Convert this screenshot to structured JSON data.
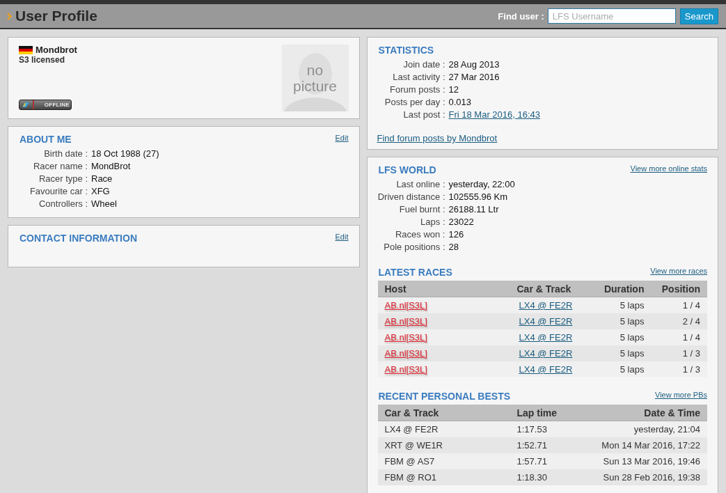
{
  "header": {
    "title": "User Profile",
    "find_label": "Find user :",
    "search": {
      "placeholder": "LFS Username"
    },
    "search_button": "Search"
  },
  "profile": {
    "name": "Mondbrot",
    "license": "S3 licensed",
    "status": "OFFLINE",
    "online": false,
    "picture_text": "no picture"
  },
  "about": {
    "title": "ABOUT ME",
    "edit": "Edit",
    "fields": [
      {
        "label": "Birth date :",
        "value": "18 Oct 1988 (27)"
      },
      {
        "label": "Racer name :",
        "value": "MondBrot"
      },
      {
        "label": "Racer type :",
        "value": "Race"
      },
      {
        "label": "Favourite car :",
        "value": "XFG"
      },
      {
        "label": "Controllers :",
        "value": "Wheel"
      }
    ]
  },
  "contact": {
    "title": "CONTACT INFORMATION",
    "edit": "Edit"
  },
  "statistics": {
    "title": "STATISTICS",
    "fields": [
      {
        "label": "Join date :",
        "value": "28 Aug 2013",
        "kind": "text"
      },
      {
        "label": "Last activity :",
        "value": "27 Mar 2016",
        "kind": "text"
      },
      {
        "label": "Forum posts :",
        "value": "12",
        "kind": "text"
      },
      {
        "label": "Posts per day :",
        "value": "0.013",
        "kind": "text"
      },
      {
        "label": "Last post :",
        "value": "Fri 18 Mar 2016, 16:43",
        "kind": "link"
      }
    ],
    "link": "Find forum posts by Mondbrot"
  },
  "lfs_world": {
    "title": "LFS WORLD",
    "link": "View more online stats",
    "fields": [
      {
        "label": "Last online :",
        "value": "yesterday, 22:00"
      },
      {
        "label": "Driven distance :",
        "value": "102555.96 Km"
      },
      {
        "label": "Fuel burnt :",
        "value": "26188.11 Ltr"
      },
      {
        "label": "Laps :",
        "value": "23022"
      },
      {
        "label": "Races won :",
        "value": "126"
      },
      {
        "label": "Pole positions :",
        "value": "28"
      }
    ]
  },
  "latest_races": {
    "title": "LATEST RACES",
    "link": "View more races",
    "columns": [
      "Host",
      "Car & Track",
      "Duration",
      "Position"
    ],
    "rows": [
      [
        "AB.nl[S3L]",
        "LX4 @ FE2R",
        "5 laps",
        "1 / 4"
      ],
      [
        "AB.nl[S3L]",
        "LX4 @ FE2R",
        "5 laps",
        "2 / 4"
      ],
      [
        "AB.nl[S3L]",
        "LX4 @ FE2R",
        "5 laps",
        "1 / 4"
      ],
      [
        "AB.nl[S3L]",
        "LX4 @ FE2R",
        "5 laps",
        "1 / 3"
      ],
      [
        "AB.nl[S3L]",
        "LX4 @ FE2R",
        "5 laps",
        "1 / 3"
      ]
    ]
  },
  "personal_bests": {
    "title": "RECENT PERSONAL BESTS",
    "link": "View more PBs",
    "columns": [
      "Car & Track",
      "Lap time",
      "Date & Time"
    ],
    "rows": [
      [
        "LX4 @ FE2R",
        "1:17.53",
        "yesterday, 21:04"
      ],
      [
        "XRT @ WE1R",
        "1:52.71",
        "Mon 14 Mar 2016, 17:22"
      ],
      [
        "FBM @ AS7",
        "1:57.71",
        "Sun 13 Mar 2016, 19:46"
      ],
      [
        "FBM @ RO1",
        "1:18.30",
        "Sun 28 Feb 2016, 19:38"
      ]
    ]
  }
}
